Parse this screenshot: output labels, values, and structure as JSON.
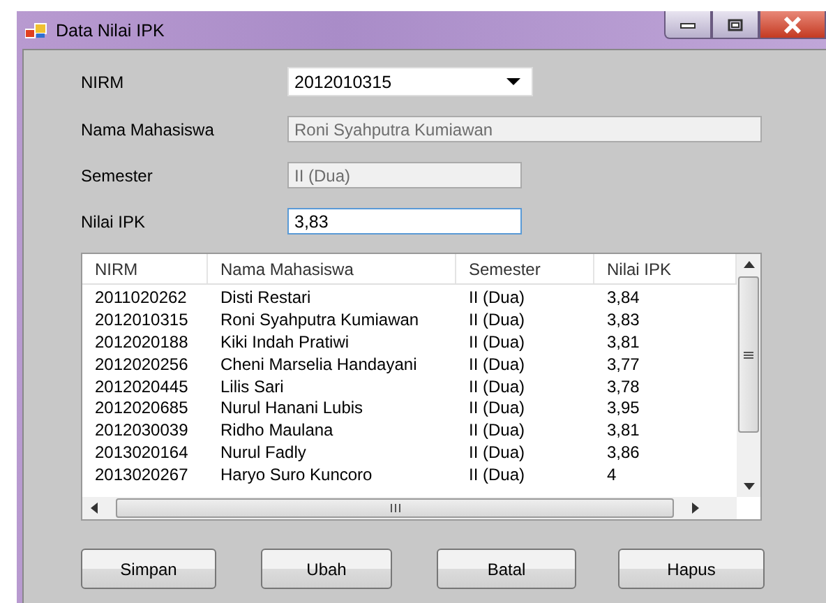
{
  "window": {
    "title": "Data Nilai IPK"
  },
  "fields": [
    {
      "label": "NIRM",
      "kind": "combo",
      "value": "2012010315",
      "disabled": false,
      "wide": false
    },
    {
      "label": "Nama Mahasiswa",
      "kind": "text",
      "value": "Roni Syahputra Kumiawan",
      "disabled": true,
      "wide": true
    },
    {
      "label": "Semester",
      "kind": "text",
      "value": "II (Dua)",
      "disabled": true,
      "wide": false
    },
    {
      "label": "Nilai IPK",
      "kind": "text",
      "value": "3,83",
      "disabled": false,
      "wide": false
    }
  ],
  "table": {
    "columns": [
      "NIRM",
      "Nama Mahasiswa",
      "Semester",
      "Nilai IPK"
    ],
    "rows": [
      [
        "2011020262",
        "Disti Restari",
        "II (Dua)",
        "3,84"
      ],
      [
        "2012010315",
        "Roni Syahputra Kumiawan",
        "II (Dua)",
        "3,83"
      ],
      [
        "2012020188",
        "Kiki Indah Pratiwi",
        "II (Dua)",
        "3,81"
      ],
      [
        "2012020256",
        "Cheni Marselia Handayani",
        "II (Dua)",
        "3,77"
      ],
      [
        "2012020445",
        "Lilis Sari",
        "II (Dua)",
        "3,78"
      ],
      [
        "2012020685",
        "Nurul Hanani Lubis",
        "II (Dua)",
        "3,95"
      ],
      [
        "2012030039",
        "Ridho Maulana",
        "II (Dua)",
        "3,81"
      ],
      [
        "2013020164",
        "Nurul Fadly",
        "II (Dua)",
        "3,86"
      ],
      [
        "2013020267",
        "Haryo Suro Kuncoro",
        "II (Dua)",
        "4"
      ]
    ]
  },
  "buttons": [
    "Simpan",
    "Ubah",
    "Batal",
    "Hapus"
  ]
}
